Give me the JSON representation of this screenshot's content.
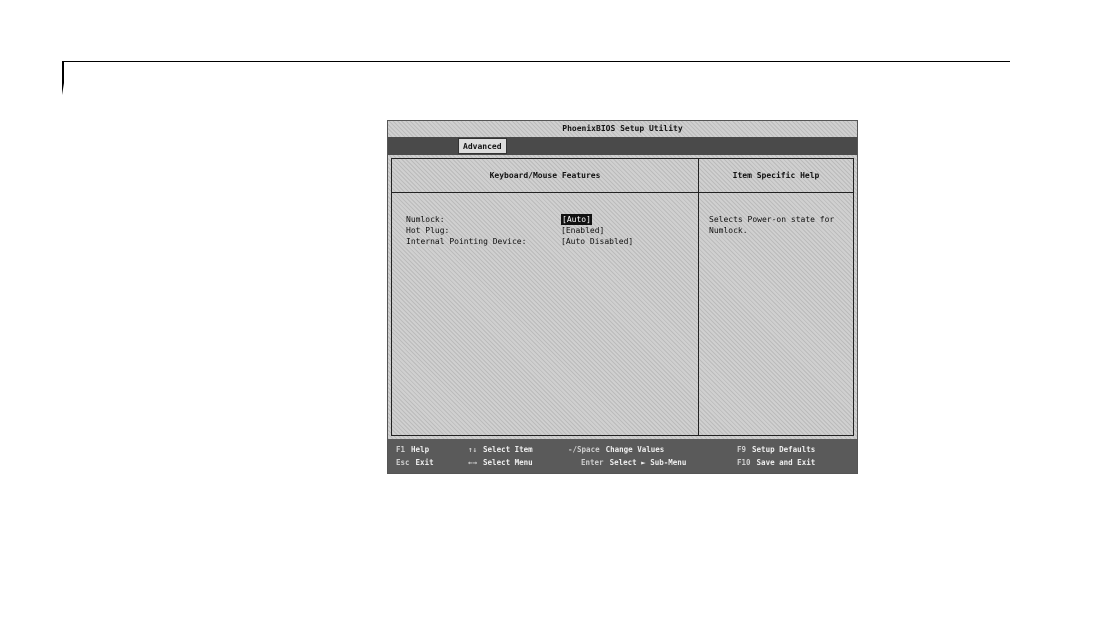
{
  "bios": {
    "title": "PhoenixBIOS Setup Utility",
    "active_tab": "Advanced",
    "left_panel_title": "Keyboard/Mouse Features",
    "right_panel_title": "Item Specific Help",
    "settings": [
      {
        "label": "Numlock:",
        "value": "[Auto]",
        "selected": true
      },
      {
        "label": "Hot Plug:",
        "value": "[Enabled]",
        "selected": false
      },
      {
        "label": "Internal Pointing Device:",
        "value": "[Auto Disabled]",
        "selected": false
      }
    ],
    "help_text": "Selects Power-on state for Numlock."
  },
  "footer": {
    "row1": [
      {
        "key": "F1",
        "action": "Help"
      },
      {
        "key": "↑↓",
        "action": "Select Item"
      },
      {
        "key": "-/Space",
        "action": "Change Values"
      },
      {
        "key": "F9",
        "action": "Setup Defaults"
      }
    ],
    "row2": [
      {
        "key": "Esc",
        "action": "Exit"
      },
      {
        "key": "←→",
        "action": "Select Menu"
      },
      {
        "key": "Enter",
        "action": "Select ► Sub-Menu"
      },
      {
        "key": "F10",
        "action": "Save and Exit"
      }
    ]
  }
}
